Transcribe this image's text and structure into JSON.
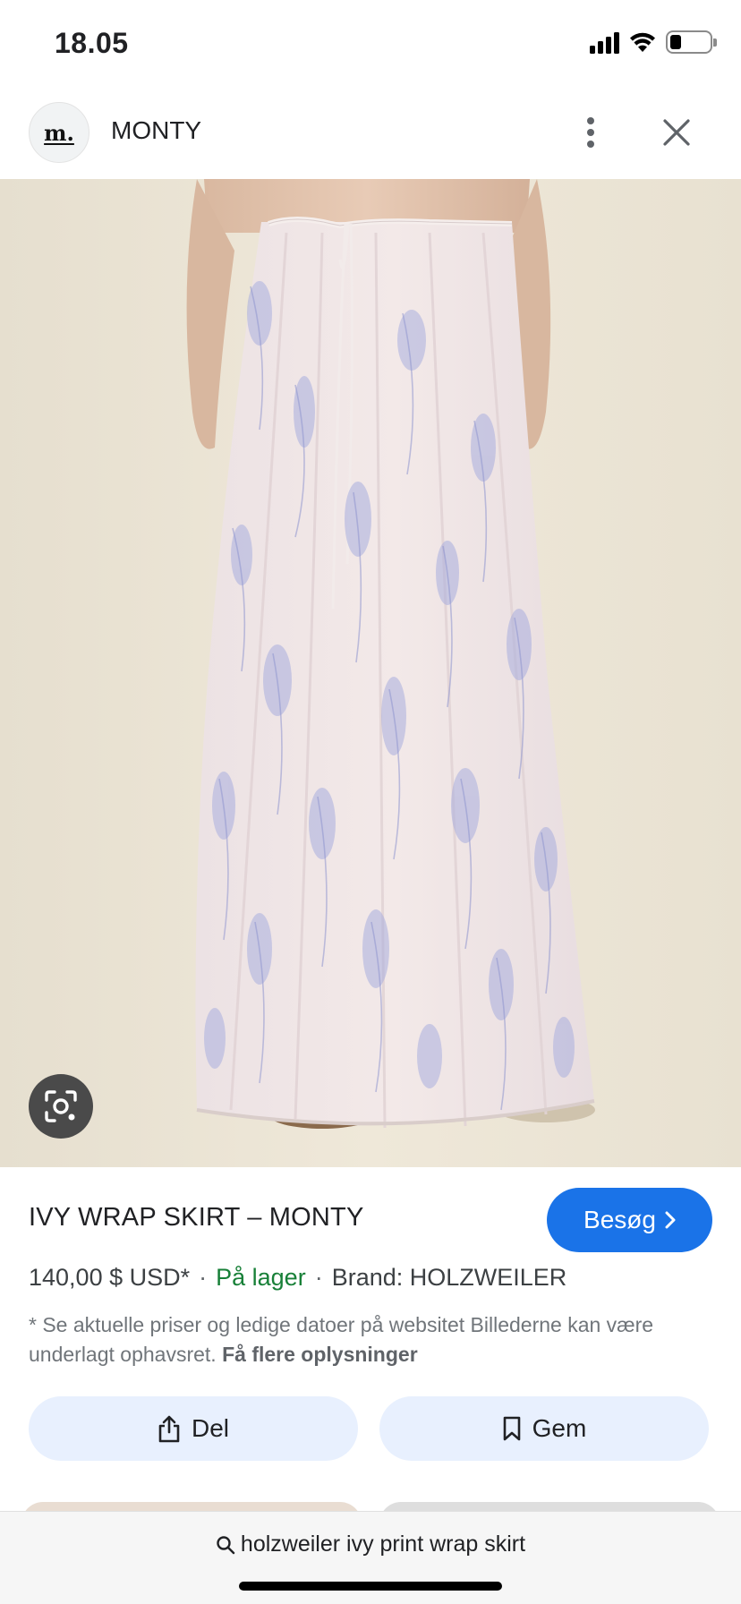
{
  "status_bar": {
    "time": "18.05",
    "icons": [
      "cellular-signal-icon",
      "wifi-icon",
      "battery-icon"
    ],
    "battery_level": 0.3
  },
  "header": {
    "logo_text": "m.",
    "site_name": "MONTY",
    "icons": [
      "more-vert-icon",
      "close-icon"
    ]
  },
  "image": {
    "description_icon": "lens-icon"
  },
  "product": {
    "title": "IVY WRAP SKIRT – MONTY",
    "visit_label": "Besøg",
    "price": "140,00 $ USD*",
    "separator": "·",
    "stock": "På lager",
    "brand": "Brand: HOLZWEILER",
    "disclaimer": "* Se aktuelle priser og ledige datoer på websitet Billederne kan være underlagt ophavsret.",
    "more_info": "Få flere oplysninger"
  },
  "actions": {
    "share_label": "Del",
    "save_label": "Gem"
  },
  "search": {
    "query": "holzweiler ivy print wrap skirt"
  },
  "colors": {
    "accent": "#1a73e8",
    "in_stock": "#188038",
    "action_bg": "#e8f0fe"
  }
}
